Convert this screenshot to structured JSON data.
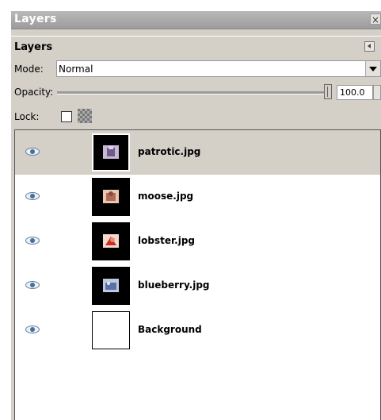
{
  "window": {
    "title": "Layers",
    "close_glyph": "×"
  },
  "panel": {
    "heading": "Layers",
    "menu_icon": "panel-menu-arrow-icon",
    "mode_label": "Mode:",
    "mode_value": "Normal",
    "opacity_label": "Opacity:",
    "opacity_value": "100.0",
    "lock_label": "Lock:"
  },
  "layers": [
    {
      "name": "patrotic.jpg",
      "visible": true,
      "selected": true,
      "thumb_colors": [
        "#6f5a8a",
        "#c9b7d8"
      ]
    },
    {
      "name": "moose.jpg",
      "visible": true,
      "selected": false,
      "thumb_colors": [
        "#b06a5a",
        "#e8c9b0"
      ]
    },
    {
      "name": "lobster.jpg",
      "visible": true,
      "selected": false,
      "thumb_colors": [
        "#c83020",
        "#f08a70"
      ]
    },
    {
      "name": "blueberry.jpg",
      "visible": true,
      "selected": false,
      "thumb_colors": [
        "#5a70a8",
        "#c0c8e0"
      ]
    },
    {
      "name": "Background",
      "visible": true,
      "selected": false,
      "thumb_colors": []
    }
  ],
  "colors": {
    "selected_row": "#d4d0c8",
    "panel_bg": "#d4d0c8"
  }
}
